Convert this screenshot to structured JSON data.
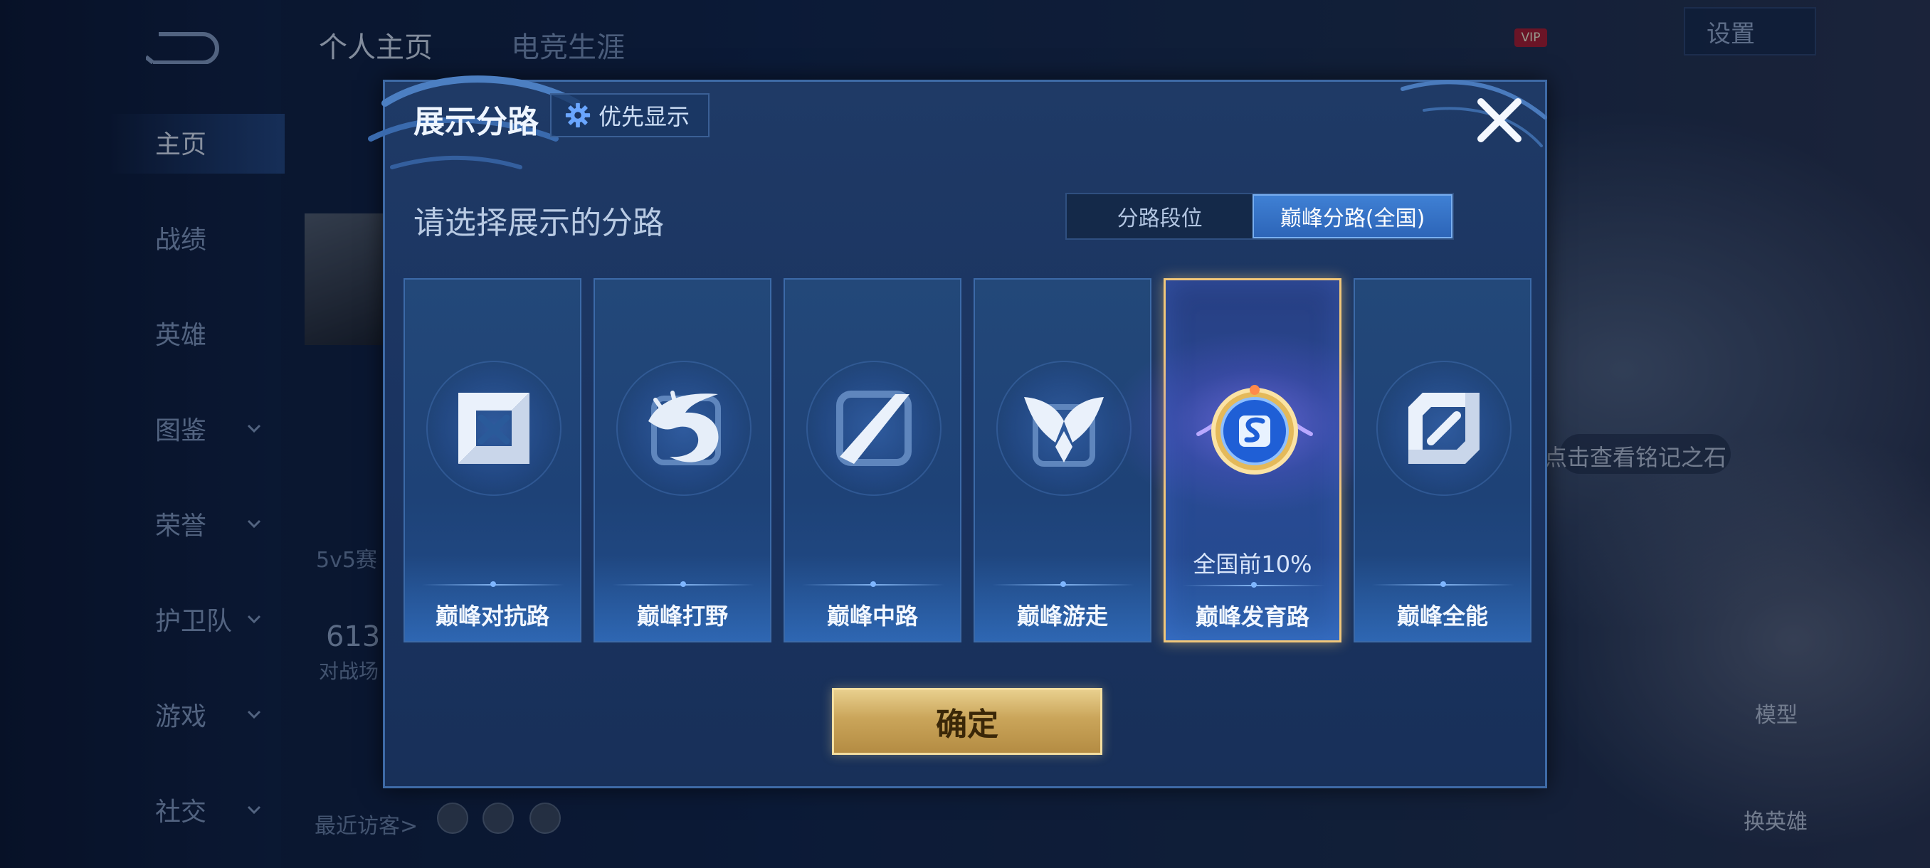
{
  "background": {
    "top_tabs": [
      "个人主页",
      "电竞生涯"
    ],
    "nav_items": [
      {
        "label": "主页",
        "has_chevron": false,
        "active": true
      },
      {
        "label": "战绩",
        "has_chevron": false
      },
      {
        "label": "英雄",
        "has_chevron": false
      },
      {
        "label": "图鉴",
        "has_chevron": true
      },
      {
        "label": "荣誉",
        "has_chevron": true
      },
      {
        "label": "护卫队",
        "has_chevron": true
      },
      {
        "label": "游戏",
        "has_chevron": true
      },
      {
        "label": "社交",
        "has_chevron": true
      }
    ],
    "stat_5v5": "5v5赛",
    "stat_number": "613",
    "stat_battle": "对战场",
    "recent_visitors": "最近访客>",
    "settings": "设置",
    "vip": "VIP",
    "side_hint": "点击查看铭记之石",
    "model": "模型",
    "switch_hero": "换英雄"
  },
  "modal": {
    "title": "展示分路",
    "priority_button": "优先显示",
    "prompt": "请选择展示的分路",
    "segment": {
      "options": [
        "分路段位",
        "巅峰分路(全国)"
      ],
      "selected": "巅峰分路(全国)"
    },
    "cards": [
      {
        "label": "巅峰对抗路",
        "icon": "clash-lane-icon",
        "rank": ""
      },
      {
        "label": "巅峰打野",
        "icon": "jungle-dragon-icon",
        "rank": ""
      },
      {
        "label": "巅峰中路",
        "icon": "mid-lane-icon",
        "rank": ""
      },
      {
        "label": "巅峰游走",
        "icon": "roam-wings-icon",
        "rank": ""
      },
      {
        "label": "巅峰发育路",
        "icon": "farm-lane-badge-icon",
        "rank": "全国前10%",
        "selected": true
      },
      {
        "label": "巅峰全能",
        "icon": "all-round-icon",
        "rank": ""
      }
    ],
    "confirm": "确定"
  },
  "colors": {
    "modal_bg": "#1f3a66",
    "selected_border": "#f1c77a",
    "segment_selected": "#3f80d4",
    "confirm_gold": "#caa55a"
  }
}
